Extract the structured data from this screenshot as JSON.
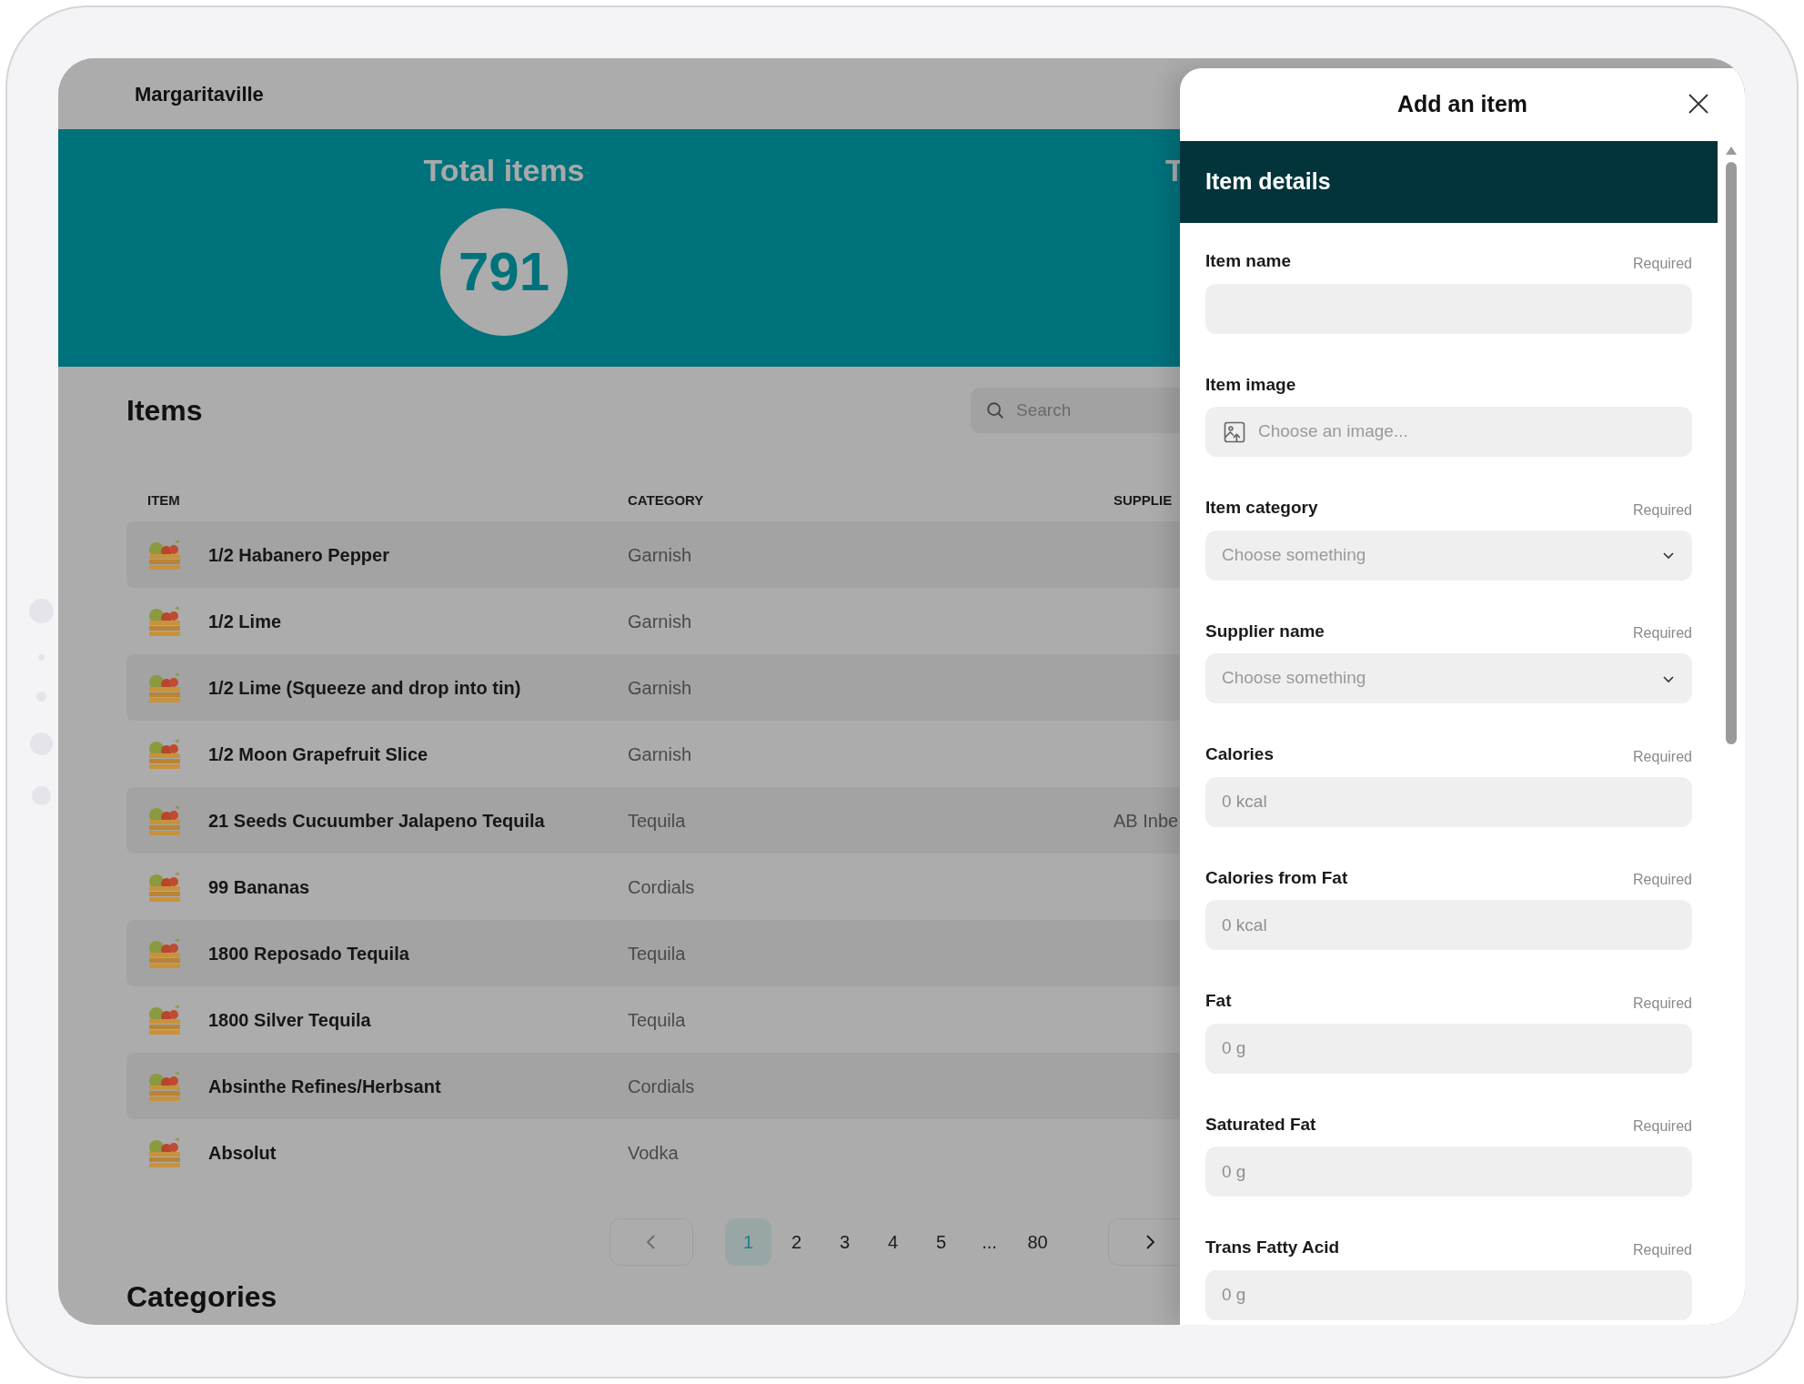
{
  "app": {
    "title": "Margaritaville"
  },
  "stats": [
    {
      "title": "Total items",
      "value": "791"
    },
    {
      "title": "T"
    }
  ],
  "items_section": {
    "title": "Items",
    "search": {
      "placeholder": "Search"
    }
  },
  "table": {
    "columns": [
      "ITEM",
      "CATEGORY",
      "SUPPLIE"
    ],
    "rows": [
      {
        "item": "1/2 Habanero Pepper",
        "category": "Garnish"
      },
      {
        "item": "1/2 Lime",
        "category": "Garnish"
      },
      {
        "item": "1/2 Lime (Squeeze and drop into tin)",
        "category": "Garnish"
      },
      {
        "item": "1/2 Moon Grapefruit Slice",
        "category": "Garnish"
      },
      {
        "item": "21 Seeds Cucuumber Jalapeno Tequila",
        "category": "Tequila",
        "supplier": "AB Inbe"
      },
      {
        "item": "99 Bananas",
        "category": "Cordials"
      },
      {
        "item": "1800 Reposado Tequila",
        "category": "Tequila"
      },
      {
        "item": "1800 Silver Tequila",
        "category": "Tequila"
      },
      {
        "item": "Absinthe Refines/Herbsant",
        "category": "Cordials"
      },
      {
        "item": "Absolut",
        "category": "Vodka"
      }
    ]
  },
  "pagination": {
    "pages": [
      {
        "label": "1",
        "selected": true
      },
      {
        "label": "2",
        "selected": false
      },
      {
        "label": "3",
        "selected": false
      },
      {
        "label": "4",
        "selected": false
      },
      {
        "label": "5",
        "selected": false
      },
      {
        "label": "...",
        "selected": false
      },
      {
        "label": "80",
        "selected": false
      }
    ]
  },
  "categories_section": {
    "title": "Categories"
  },
  "panel": {
    "title": "Add an item",
    "section": "Item details",
    "fields": [
      {
        "label": "Item name",
        "note": "Required",
        "kind": "text"
      },
      {
        "label": "Item image",
        "kind": "image",
        "placeholder": "Choose an image..."
      },
      {
        "label": "Item category",
        "note": "Required",
        "kind": "select",
        "placeholder": "Choose something"
      },
      {
        "label": "Supplier name",
        "note": "Required",
        "kind": "select",
        "placeholder": "Choose something"
      },
      {
        "label": "Calories",
        "note": "Required",
        "kind": "text",
        "placeholder": "0 kcal"
      },
      {
        "label": "Calories from Fat",
        "note": "Required",
        "kind": "text",
        "placeholder": "0 kcal"
      },
      {
        "label": "Fat",
        "note": "Required",
        "kind": "text",
        "placeholder": "0 g"
      },
      {
        "label": "Saturated Fat",
        "note": "Required",
        "kind": "text",
        "placeholder": "0 g"
      },
      {
        "label": "Trans Fatty Acid",
        "note": "Required",
        "kind": "text",
        "placeholder": "0 g"
      }
    ]
  }
}
